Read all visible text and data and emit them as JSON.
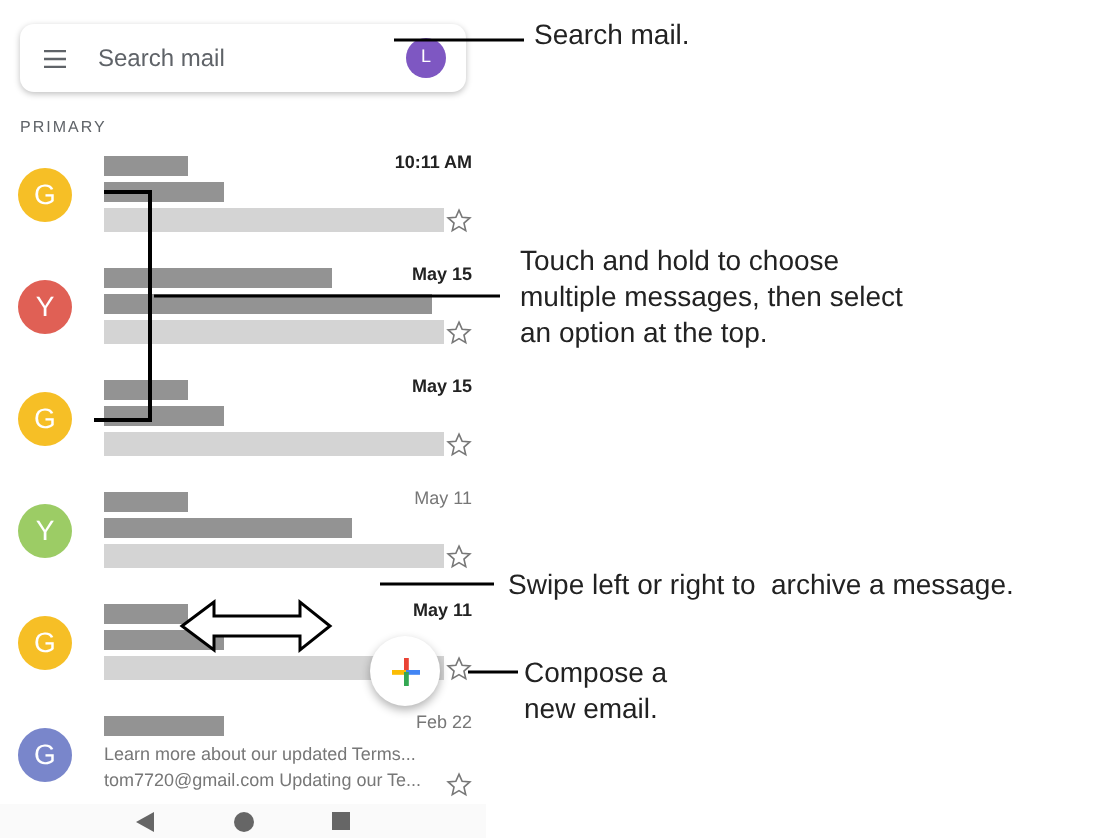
{
  "search": {
    "placeholder": "Search mail",
    "account_initial": "L"
  },
  "section_label": "PRIMARY",
  "emails": [
    {
      "initial": "G",
      "color": "#f6bf26",
      "time": "10:11 AM",
      "unread": true,
      "starred": false
    },
    {
      "initial": "Y",
      "color": "#e06055",
      "time": "May 15",
      "unread": true,
      "starred": false
    },
    {
      "initial": "G",
      "color": "#f6bf26",
      "time": "May 15",
      "unread": true,
      "starred": false
    },
    {
      "initial": "Y",
      "color": "#9ccc65",
      "time": "May 11",
      "unread": false,
      "starred": false
    },
    {
      "initial": "G",
      "color": "#f6bf26",
      "time": "May 11",
      "unread": true,
      "starred": false
    },
    {
      "initial": "G",
      "color": "#7986cb",
      "time": "Feb 22",
      "unread": false,
      "starred": false,
      "preview_lines": [
        "Learn more about our updated Terms...",
        "tom7720@gmail.com Updating our Te..."
      ]
    }
  ],
  "annotations": [
    {
      "kind": "search",
      "text": "Search mail."
    },
    {
      "kind": "hold",
      "text": "Touch and hold to choose\nmultiple messages, then select\nan option at the top."
    },
    {
      "kind": "swipe",
      "text": "Swipe left or right to  archive a message."
    },
    {
      "kind": "compose",
      "text": "Compose a\nnew email."
    }
  ]
}
